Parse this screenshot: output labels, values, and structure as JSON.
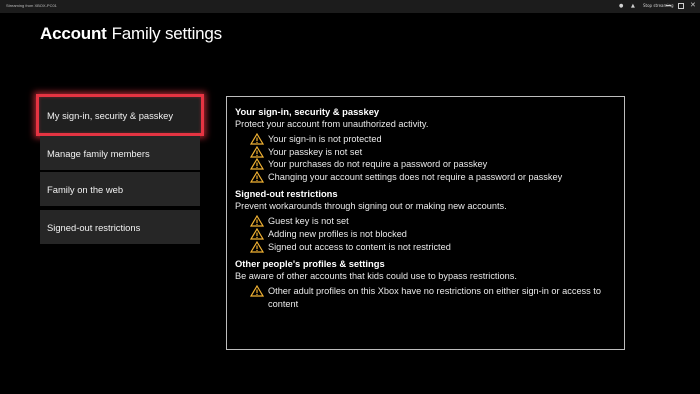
{
  "titlebar": {
    "app_title": "Streaming from XBOX-PC01",
    "status_text": "Stop streaming"
  },
  "header": {
    "title_bold": "Account",
    "title_rest": "Family settings"
  },
  "nav": {
    "items": [
      {
        "label": "My sign-in, security & passkey"
      },
      {
        "label": "Manage family members"
      },
      {
        "label": "Family on the web"
      },
      {
        "label": "Signed-out restrictions"
      }
    ]
  },
  "panel": {
    "sections": [
      {
        "title": "Your sign-in, security & passkey",
        "description": "Protect your account from unauthorized activity.",
        "warnings": [
          "Your sign-in is not protected",
          "Your passkey is not set",
          "Your purchases do not require a password or passkey",
          "Changing your account settings does not require a password or passkey"
        ]
      },
      {
        "title": "Signed-out restrictions",
        "description": "Prevent workarounds through signing out or making new accounts.",
        "warnings": [
          "Guest key is not set",
          "Adding new profiles is not blocked",
          "Signed out access to content is not restricted"
        ]
      },
      {
        "title": "Other people's profiles & settings",
        "description": "Be aware of other accounts that kids could use to bypass restrictions.",
        "warnings": [
          "Other adult profiles on this Xbox have no restrictions on either sign-in or access to content"
        ]
      }
    ]
  },
  "colors": {
    "selection_border": "#e53442",
    "warning_icon": "#f2b233",
    "nav_bg": "#262626"
  }
}
